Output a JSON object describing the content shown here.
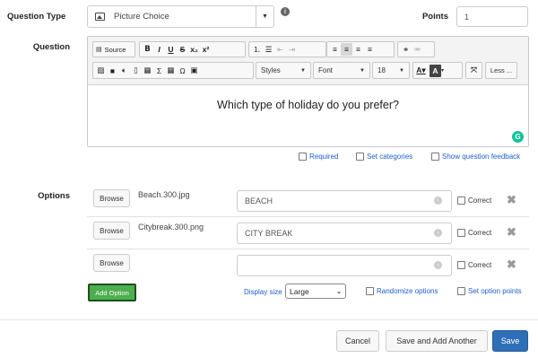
{
  "question_type": {
    "label": "Question Type",
    "value": "Picture Choice"
  },
  "points": {
    "label": "Points",
    "value": "1"
  },
  "question": {
    "label": "Question",
    "content": "Which type of holiday do you prefer?"
  },
  "toolbar": {
    "source_label": "Source",
    "styles_label": "Styles",
    "font_label": "Font",
    "size_label": "18",
    "less_label": "Less ..."
  },
  "question_links": {
    "required": "Required",
    "set_categories": "Set categories",
    "show_feedback": "Show question feedback"
  },
  "options": {
    "label": "Options",
    "browse_label": "Browse",
    "correct_label": "Correct",
    "items": [
      {
        "file": "Beach.300.jpg",
        "text": "BEACH"
      },
      {
        "file": "Citybreak.300.png",
        "text": "CITY BREAK"
      },
      {
        "file": "",
        "text": ""
      }
    ],
    "add_option": "Add Option",
    "display_size_label": "Display size",
    "display_size_value": "Large",
    "randomize": "Randomize options",
    "set_points": "Set option points"
  },
  "footer": {
    "cancel": "Cancel",
    "save_add": "Save and Add Another",
    "save": "Save"
  },
  "colors": {
    "accent_blue": "#2f6fb8",
    "add_green": "#4cae4c",
    "link_blue": "#1f5fcf"
  }
}
